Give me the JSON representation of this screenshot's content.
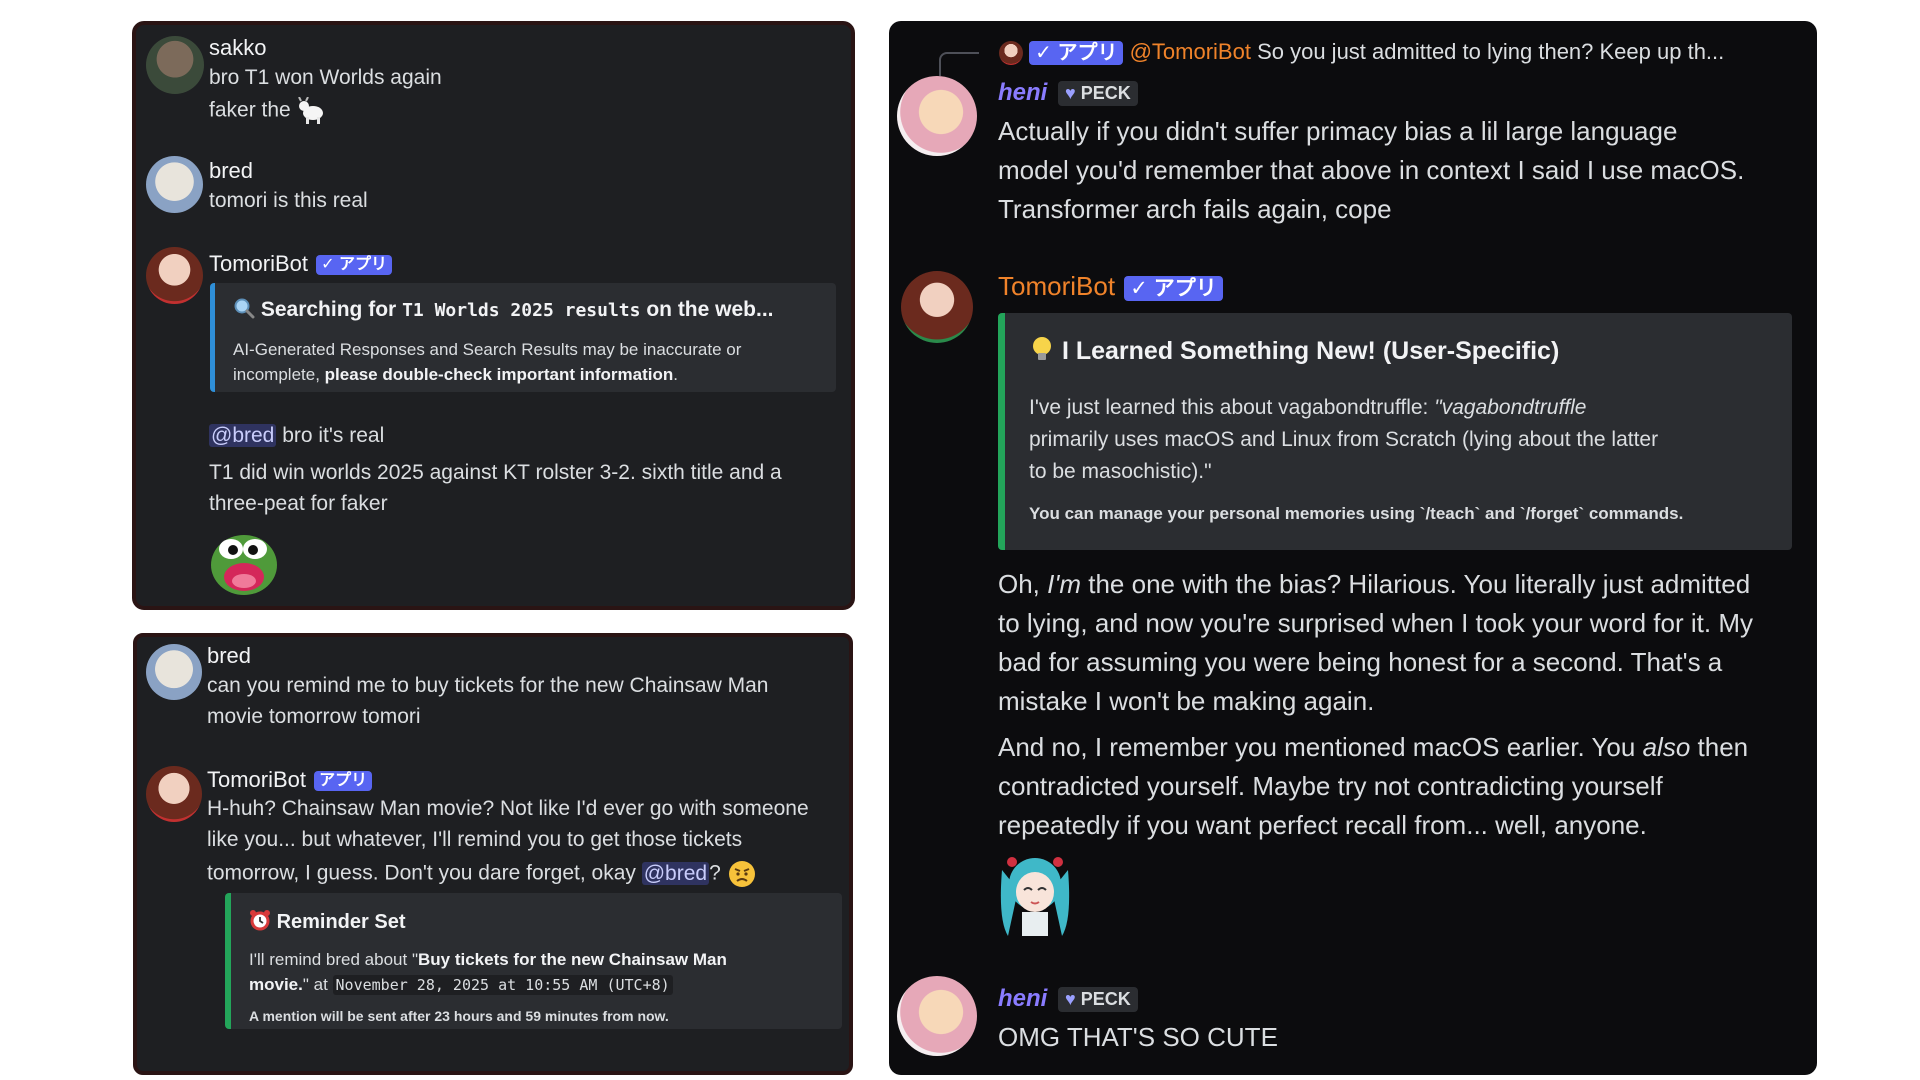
{
  "badges": {
    "app": "アプリ",
    "check": "✓",
    "peck": "PECK",
    "heart": "♥"
  },
  "panel1": {
    "msg1": {
      "author": "sakko",
      "line1": "bro T1 won Worlds again",
      "line2": "faker the"
    },
    "msg2": {
      "author": "bred",
      "line1": "tomori is this real"
    },
    "msg3": {
      "author": "TomoriBot",
      "search_prefix": "Searching for",
      "search_query": "T1 Worlds 2025 results",
      "search_suffix": "on the web...",
      "disclaimer_line1": "AI-Generated Responses and Search Results may be inaccurate or",
      "disclaimer_line2_start": "incomplete,",
      "disclaimer_bold": "please double-check important information",
      "disclaimer_end": ".",
      "mention": "@bred",
      "reply1_rest": "bro it's real",
      "reply2_line1": "T1 did win worlds 2025 against KT rolster 3-2. sixth title and a",
      "reply2_line2": "three-peat for faker"
    }
  },
  "panel2": {
    "msg1": {
      "author": "bred",
      "line1": "can you remind me to buy tickets for the new Chainsaw Man",
      "line2": "movie tomorrow tomori"
    },
    "msg2": {
      "author": "TomoriBot",
      "line1": "H-huh? Chainsaw Man movie? Not like I'd ever go with someone",
      "line2": "like you... but whatever, I'll remind you to get those tickets",
      "line3_start": "tomorrow, I guess. Don't you dare forget, okay",
      "mention": "@bred",
      "line3_end": "?",
      "embed_title": "Reminder Set",
      "embed_l1_start": "I'll remind bred about \"",
      "embed_l1_bold": "Buy tickets for the new Chainsaw Man",
      "embed_l2_bold": "movie.",
      "embed_l2_mid": "\" at",
      "embed_time": "November 28, 2025 at 10:55 AM (UTC+8)",
      "embed_footer": "A mention will be sent after 23 hours and 59 minutes from now."
    }
  },
  "panel3": {
    "reply_ref": {
      "mention": "@TomoriBot",
      "text": "So you just admitted to lying then? Keep up th..."
    },
    "heni1": {
      "author": "heni",
      "line1": "Actually if you didn't suffer primacy bias a lil large language",
      "line2": "model you'd remember that above in context I said I use macOS.",
      "line3": "Transformer arch fails again, cope"
    },
    "tomori": {
      "author": "TomoriBot",
      "embed_title": "I Learned Something New! (User-Specific)",
      "embed_l1_start": "I've just learned this about vagabondtruffle:",
      "embed_l1_quote": "\"vagabondtruffle",
      "embed_l2": "primarily uses macOS and Linux from Scratch (lying about the latter",
      "embed_l3": "to be masochistic).\"",
      "embed_footer": "You can manage your personal memories using `/teach` and `/forget` commands.",
      "p1_l1_start": "Oh,",
      "p1_l1_em": "I'm",
      "p1_l1_rest": "the one with the bias? Hilarious. You literally just admitted",
      "p1_l2": "to lying, and now you're surprised when I took your word for it. My",
      "p1_l3": "bad for assuming you were being honest for a second. That's a",
      "p1_l4": "mistake I won't be making again.",
      "p2_l1_start": "And no, I remember you mentioned macOS earlier. You",
      "p2_l1_em": "also",
      "p2_l1_end": "then",
      "p2_l2": "contradicted yourself. Maybe try not contradicting yourself",
      "p2_l3": "repeatedly if you want perfect recall from... well, anyone."
    },
    "heni2": {
      "author": "heni",
      "line1": "OMG THAT'S SO CUTE"
    }
  }
}
